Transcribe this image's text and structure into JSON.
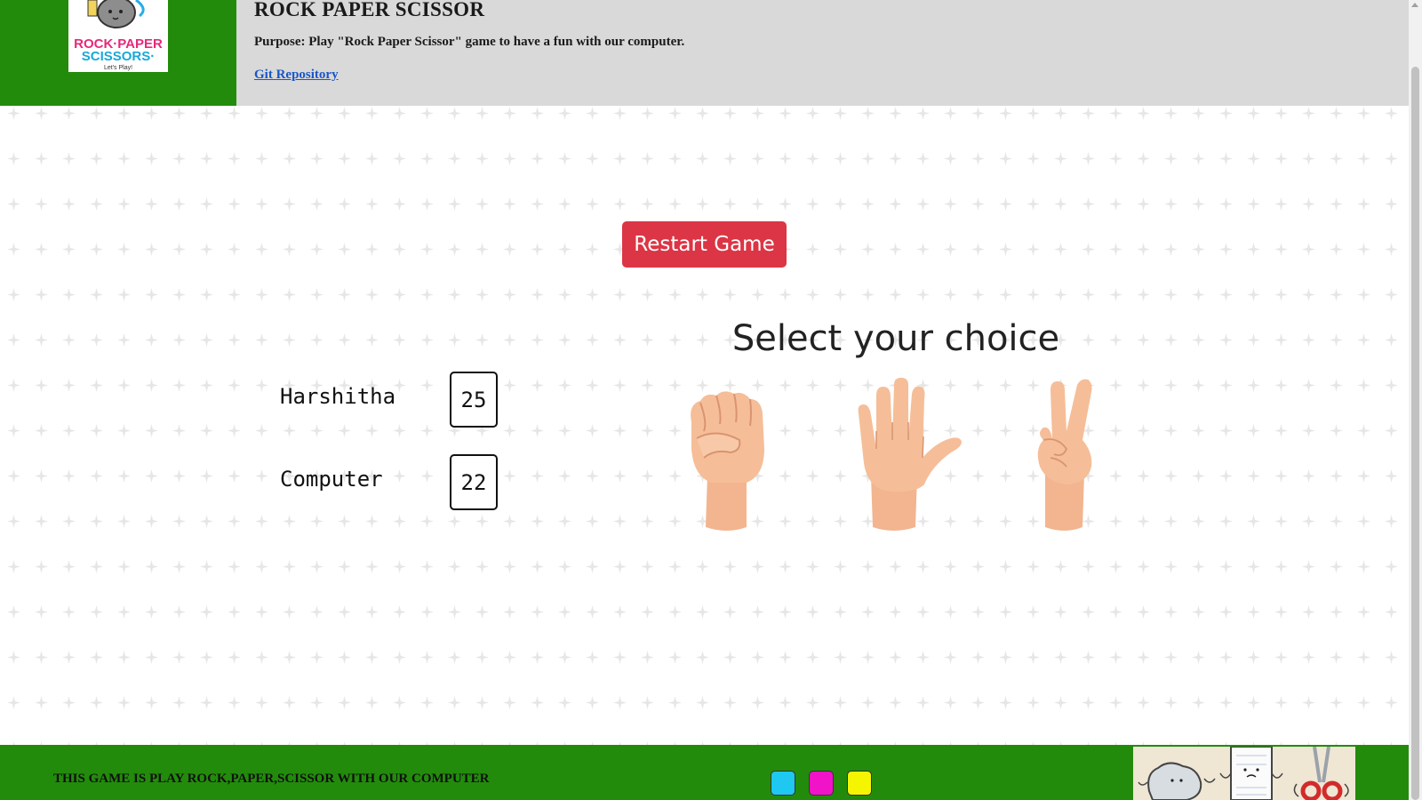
{
  "header": {
    "title": "ROCK PAPER SCISSOR",
    "purpose": "Purpose: Play \"Rock Paper Scissor\" game to have a fun with our computer.",
    "link_label": "Git Repository",
    "logo_text": {
      "line1": "ROCK·PAPER",
      "line2": "SCISSORS·",
      "tagline": "Let's Play!"
    }
  },
  "game": {
    "restart_label": "Restart Game",
    "select_title": "Select your choice",
    "players": [
      {
        "name": "Harshitha",
        "score": "25"
      },
      {
        "name": "Computer",
        "score": "22"
      }
    ],
    "choices": [
      "rock",
      "paper",
      "scissor"
    ]
  },
  "footer": {
    "text": "THIS GAME IS PLAY ROCK,PAPER,SCISSOR WITH OUR COMPUTER",
    "color_buttons": [
      "#1ec8f0",
      "#f013c8",
      "#f5f500"
    ]
  },
  "colors": {
    "accent_green": "#238b0c",
    "header_gray": "#d9d9d9",
    "restart_red": "#dc3545",
    "skin": "#f2b58f"
  }
}
